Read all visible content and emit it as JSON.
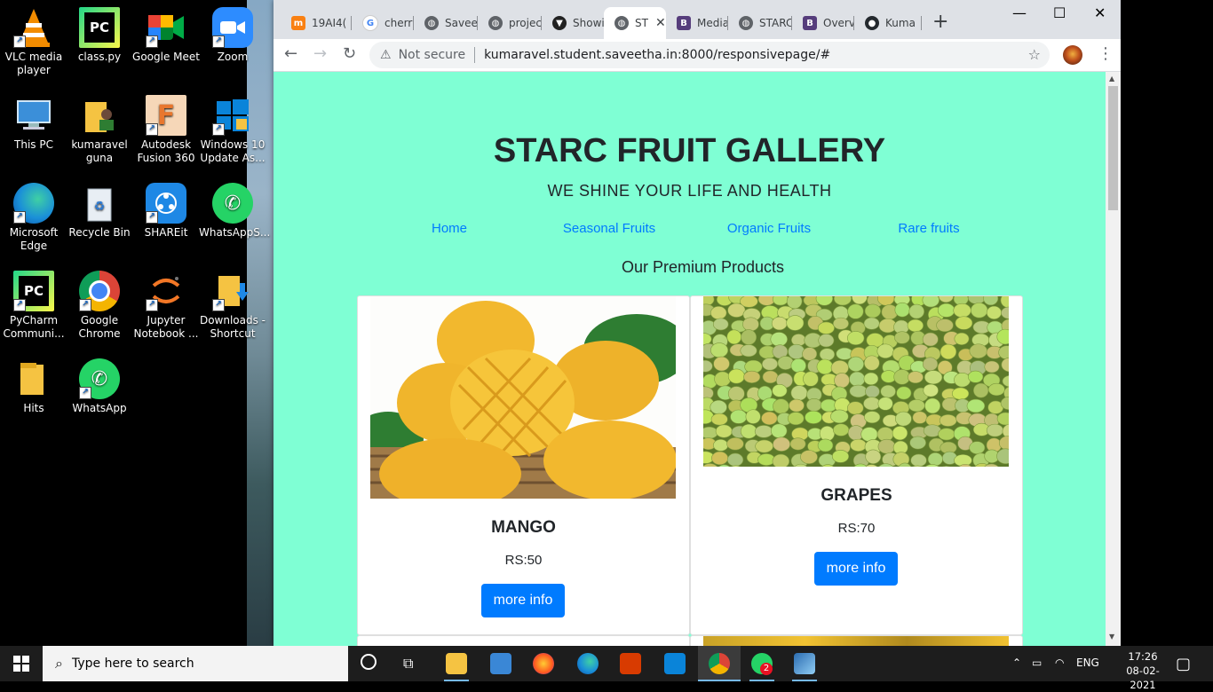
{
  "desktop": {
    "icons": [
      {
        "label": "VLC media player"
      },
      {
        "label": "class.py"
      },
      {
        "label": "Google Meet"
      },
      {
        "label": "Zoom"
      },
      {
        "label": "This PC"
      },
      {
        "label": "kumaravel guna"
      },
      {
        "label": "Autodesk Fusion 360"
      },
      {
        "label": "Windows 10 Update As..."
      },
      {
        "label": "Microsoft Edge"
      },
      {
        "label": "Recycle Bin"
      },
      {
        "label": "SHAREit"
      },
      {
        "label": "WhatsAppS..."
      },
      {
        "label": "PyCharm Communi..."
      },
      {
        "label": "Google Chrome"
      },
      {
        "label": "Jupyter Notebook ..."
      },
      {
        "label": "Downloads - Shortcut"
      },
      {
        "label": "Hits"
      },
      {
        "label": "WhatsApp"
      }
    ]
  },
  "browser": {
    "tabs": [
      {
        "label": "19AI4("
      },
      {
        "label": "cherry"
      },
      {
        "label": "Savee"
      },
      {
        "label": "projec"
      },
      {
        "label": "Showi"
      },
      {
        "label": "ST"
      },
      {
        "label": "Media"
      },
      {
        "label": "STARC"
      },
      {
        "label": "Overv"
      },
      {
        "label": "Kuma"
      }
    ],
    "new_tab": "+",
    "security": "Not secure",
    "url": "kumaravel.student.saveetha.in:8000/responsivepage/#"
  },
  "page": {
    "title": "STARC FRUIT GALLERY",
    "tagline": "WE SHINE YOUR LIFE AND HEALTH",
    "nav": [
      "Home",
      "Seasonal Fruits",
      "Organic Fruits",
      "Rare fruits"
    ],
    "section_heading": "Our Premium Products",
    "products": [
      {
        "name": "MANGO",
        "price": "RS:50",
        "button": "more info"
      },
      {
        "name": "GRAPES",
        "price": "RS:70",
        "button": "more info"
      }
    ],
    "colors": {
      "background": "#7fffd4",
      "link": "#007bff",
      "button": "#007bff"
    }
  },
  "taskbar": {
    "search_placeholder": "Type here to search",
    "language": "ENG",
    "time": "17:26",
    "date": "08-02-2021",
    "whatsapp_badge": "2"
  }
}
